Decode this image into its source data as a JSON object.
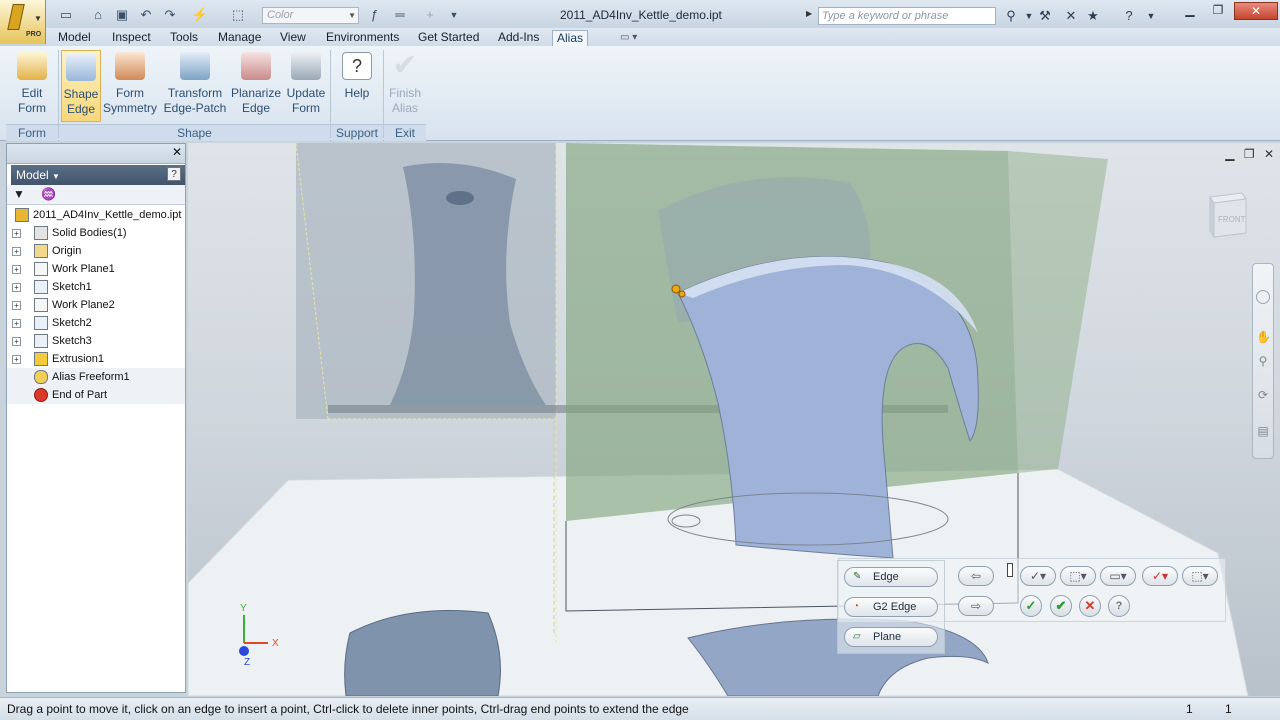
{
  "app": {
    "logo_label": "PRO",
    "document_title": "2011_AD4Inv_Kettle_demo.ipt",
    "color_combo_placeholder": "Color",
    "search_placeholder": "Type a keyword or phrase"
  },
  "menu_tabs": [
    "Model",
    "Inspect",
    "Tools",
    "Manage",
    "View",
    "Environments",
    "Get Started",
    "Add-Ins",
    "Alias"
  ],
  "active_tab": "Alias",
  "ribbon": {
    "buttons": [
      {
        "label": "Edit\nForm",
        "icon": "edit-form-icon",
        "selected": false,
        "disabled": false
      },
      {
        "label": "Shape\nEdge",
        "icon": "shape-edge-icon",
        "selected": true,
        "disabled": false
      },
      {
        "label": "Form\nSymmetry",
        "icon": "form-symmetry-icon",
        "selected": false,
        "disabled": false
      },
      {
        "label": "Transform\nEdge-Patch",
        "icon": "transform-edge-patch-icon",
        "selected": false,
        "disabled": false
      },
      {
        "label": "Planarize\nEdge",
        "icon": "planarize-edge-icon",
        "selected": false,
        "disabled": false
      },
      {
        "label": "Update\nForm",
        "icon": "update-form-icon",
        "selected": false,
        "disabled": false
      },
      {
        "label": "Help",
        "icon": "help-icon",
        "selected": false,
        "disabled": false
      },
      {
        "label": "Finish\nAlias",
        "icon": "finish-alias-icon",
        "selected": false,
        "disabled": true
      }
    ],
    "groups": [
      "Form",
      "Shape",
      "Support",
      "Exit"
    ]
  },
  "browser": {
    "title": "Model",
    "tree": [
      {
        "label": "2011_AD4Inv_Kettle_demo.ipt",
        "icon": "part-icon",
        "expandable": false
      },
      {
        "label": "Solid Bodies(1)",
        "icon": "solid-bodies-icon",
        "expandable": true
      },
      {
        "label": "Origin",
        "icon": "folder-icon",
        "expandable": true
      },
      {
        "label": "Work Plane1",
        "icon": "work-plane-icon",
        "expandable": true
      },
      {
        "label": "Sketch1",
        "icon": "sketch-icon",
        "expandable": true
      },
      {
        "label": "Work Plane2",
        "icon": "work-plane-icon",
        "expandable": true
      },
      {
        "label": "Sketch2",
        "icon": "sketch-icon",
        "expandable": true
      },
      {
        "label": "Sketch3",
        "icon": "sketch-icon",
        "expandable": true
      },
      {
        "label": "Extrusion1",
        "icon": "extrusion-icon",
        "expandable": true
      },
      {
        "label": "Alias Freeform1",
        "icon": "alias-freeform-icon",
        "expandable": false
      },
      {
        "label": "End of Part",
        "icon": "end-of-part-icon",
        "expandable": false
      }
    ]
  },
  "viewport": {
    "viewcube_face": "FRONT",
    "mini_toolbar": {
      "pills": [
        "Edge",
        "G2 Edge",
        "Plane"
      ]
    },
    "axis_labels": {
      "x": "X",
      "y": "Y",
      "z": "Z"
    }
  },
  "status": {
    "message": "Drag a point to move it, click on an edge to insert a point, Ctrl-click to delete inner points, Ctrl-drag end points to extend the edge",
    "count_a": "1",
    "count_b": "1"
  },
  "colors": {
    "accent": "#f7d778",
    "green_plane": "#7fa37a",
    "kettle_blue": "#9fb2d8"
  }
}
